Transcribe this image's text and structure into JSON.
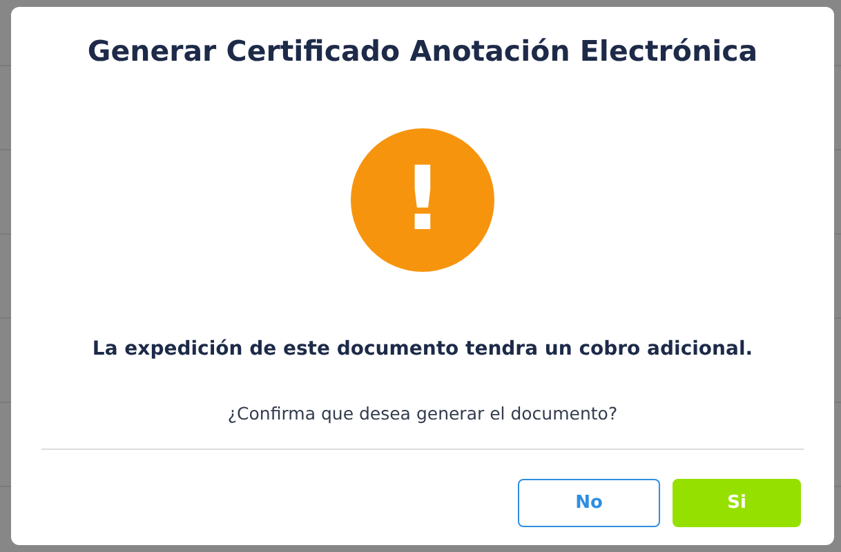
{
  "dialog": {
    "title": "Generar Certificado Anotación Electrónica",
    "icon": "!",
    "message": "La expedición de este documento tendra un cobro adicional.",
    "question": "¿Confirma que desea generar el documento?",
    "buttons": [
      {
        "label": "No",
        "kind": "cancel"
      },
      {
        "label": "Si",
        "kind": "confirm"
      }
    ]
  }
}
